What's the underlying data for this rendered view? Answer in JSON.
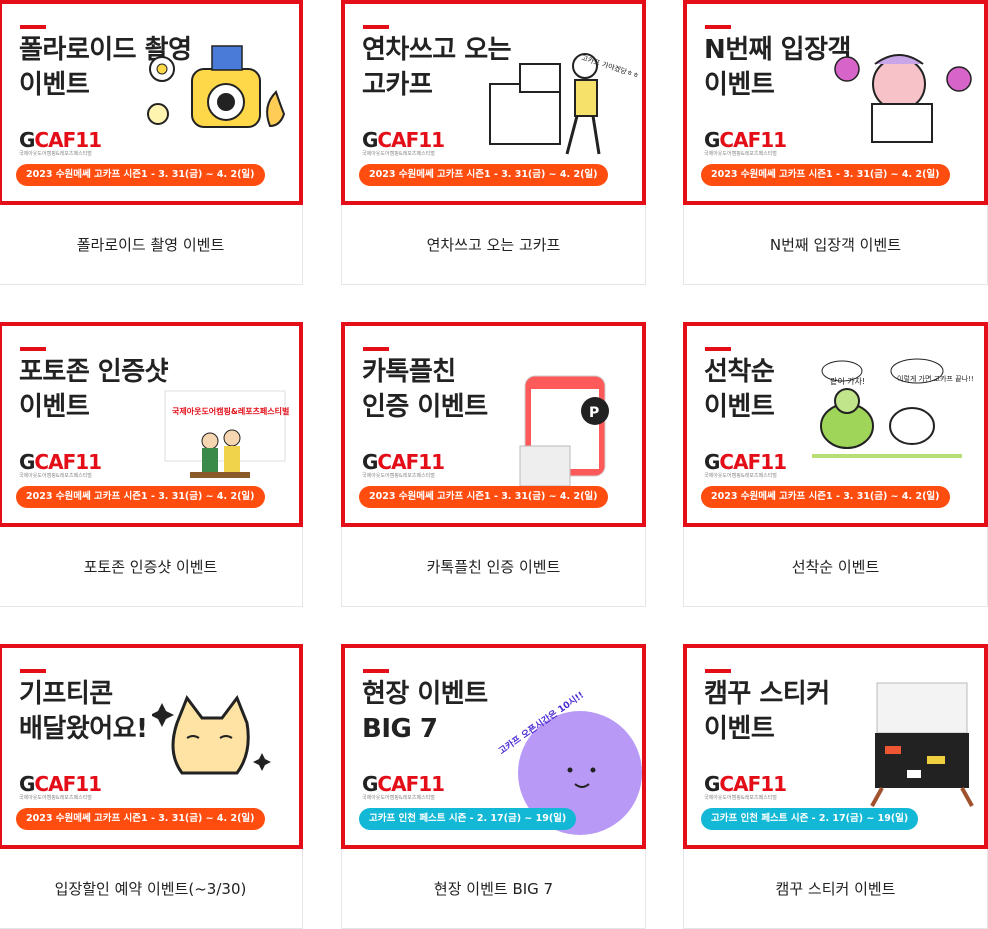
{
  "cards": [
    {
      "title": "폴라로이드 촬영\n이벤트",
      "caption": "폴라로이드 촬영 이벤트",
      "pill": "2023 수원메쎄 고카프 시즌1 - 3. 31(금) ~ 4. 2(일)",
      "pill_color": "orange",
      "art": "polaroid-camera-illustration"
    },
    {
      "title": "연차쓰고 오는\n고카프",
      "caption": "연차쓰고 오는 고카프",
      "pill": "2023 수원메쎄 고카프 시즌1 - 3. 31(금) ~ 4. 2(일)",
      "pill_color": "orange",
      "art": "office-worker-illustration",
      "bubble": "고카프 가야겠당ㅎㅎ"
    },
    {
      "title": "N번째 입장객\n이벤트",
      "caption": "N번째 입장객 이벤트",
      "pill": "2023 수원메쎄 고카프 시즌1 - 3. 31(금) ~ 4. 2(일)",
      "pill_color": "orange",
      "art": "gift-box-character-illustration"
    },
    {
      "title": "포토존 인증샷\n이벤트",
      "caption": "포토존 인증샷 이벤트",
      "pill": "2023 수원메쎄 고카프 시즌1 - 3. 31(금) ~ 4. 2(일)",
      "pill_color": "orange",
      "art": "photozone-couple-illustration",
      "photozone": "국제아웃도어캠핑&레포츠페스티벌"
    },
    {
      "title": "카톡플친\n인증 이벤트",
      "caption": "카톡플친 인증 이벤트",
      "pill": "2023 수원메쎄 고카프 시즌1 - 3. 31(금) ~ 4. 2(일)",
      "pill_color": "orange",
      "art": "kakao-plusfriend-phone-illustration"
    },
    {
      "title": "선착순\n이벤트",
      "caption": "선착순 이벤트",
      "pill": "2023 수원메쎄 고카프 시즌1 - 3. 31(금) ~ 4. 2(일)",
      "pill_color": "orange",
      "art": "turtle-rabbit-illustration",
      "bubble1": "같이 가자!",
      "bubble2": "이렇게 가면 고카프 끝나!!"
    },
    {
      "title": "기프티콘\n배달왔어요!",
      "caption": "입장할인 예약 이벤트(~3/30)",
      "pill": "2023 수원메쎄 고카프 시즌1 - 3. 31(금) ~ 4. 2(일)",
      "pill_color": "orange",
      "art": "cat-character-illustration"
    },
    {
      "title": "현장 이벤트\nBIG 7",
      "caption": "현장 이벤트 BIG 7",
      "pill": "고카프 인천 페스트 시즌 - 2. 17(금) ~ 19(일)",
      "pill_color": "cyan",
      "art": "purple-smiley-circle-illustration",
      "arc_text": "고카프 오픈시간은 10시!!"
    },
    {
      "title": "캠꾸 스티커\n이벤트",
      "caption": "캠꾸 스티커 이벤트",
      "pill": "고카프 인천 페스트 시즌 - 2. 17(금) ~ 19(일)",
      "pill_color": "cyan",
      "art": "camping-box-stickers-illustration"
    }
  ],
  "logo": {
    "g": "G",
    "mark": "CAF",
    "num": "11",
    "sub": "국제아웃도어캠핑&레포츠페스티벌"
  },
  "colors": {
    "brand_red": "#e30e18",
    "pill_orange": "#ff4d10",
    "pill_cyan": "#13b8d6"
  }
}
